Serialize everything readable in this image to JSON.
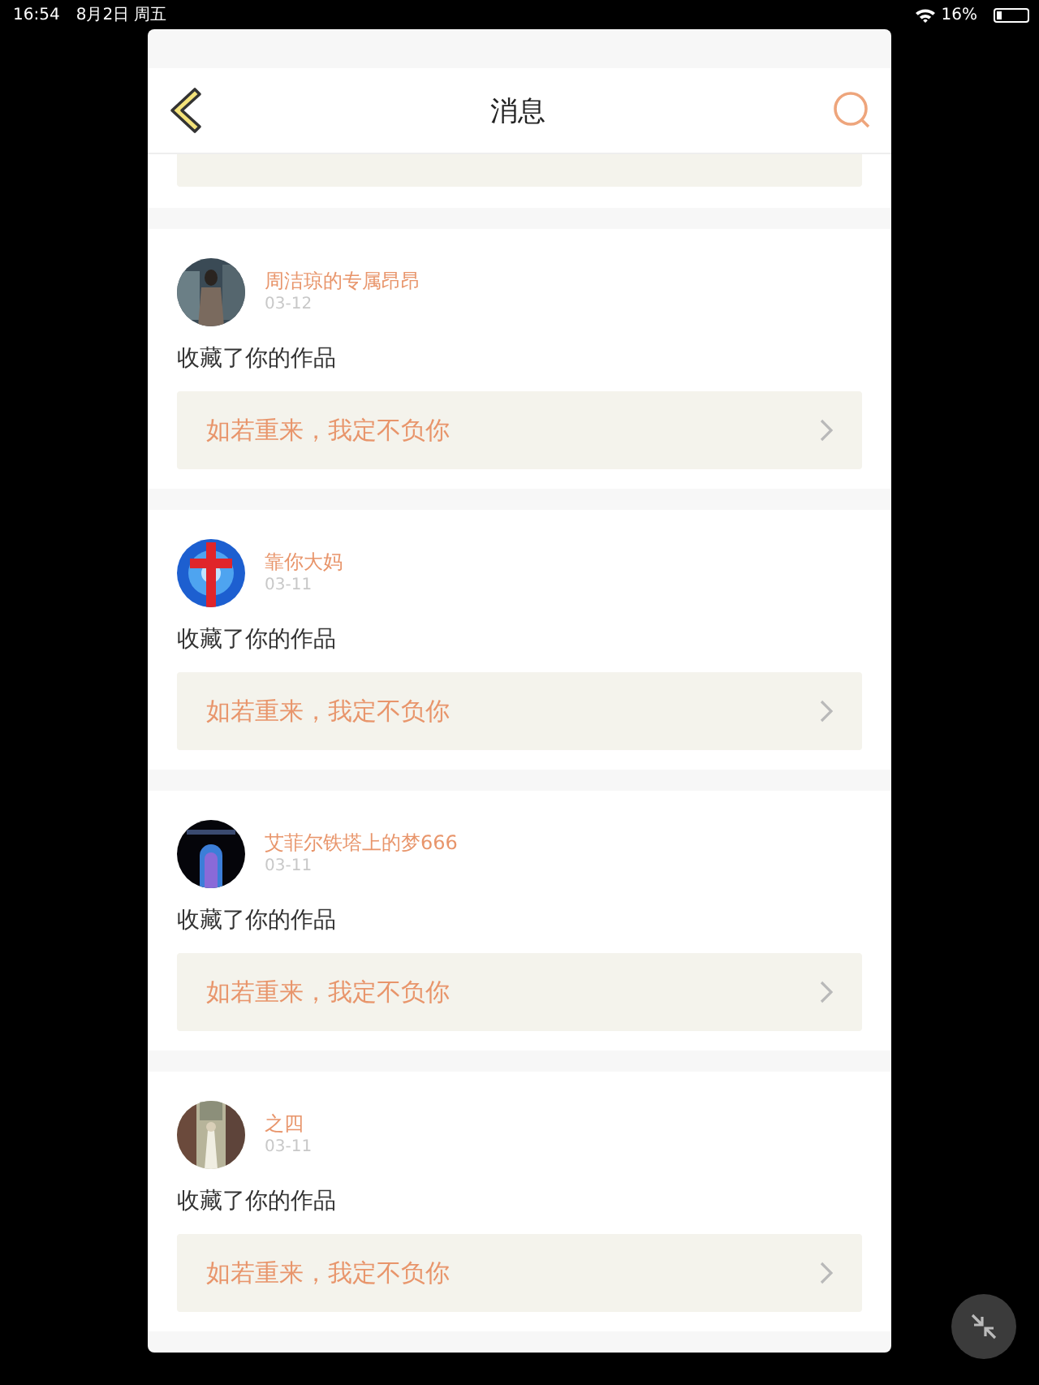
{
  "status_bar": {
    "time": "16:54",
    "date": "8月2日 周五",
    "battery": "16%"
  },
  "header": {
    "title": "消息"
  },
  "messages": [
    {
      "name": "周洁琼的专属昂昂",
      "date": "03-12",
      "action": "收藏了你的作品",
      "quote": "如若重来，我定不负你"
    },
    {
      "name": "靠你大妈",
      "date": "03-11",
      "action": "收藏了你的作品",
      "quote": "如若重来，我定不负你"
    },
    {
      "name": "艾菲尔铁塔上的梦666",
      "date": "03-11",
      "action": "收藏了你的作品",
      "quote": "如若重来，我定不负你"
    },
    {
      "name": "之四",
      "date": "03-11",
      "action": "收藏了你的作品",
      "quote": "如若重来，我定不负你"
    }
  ]
}
